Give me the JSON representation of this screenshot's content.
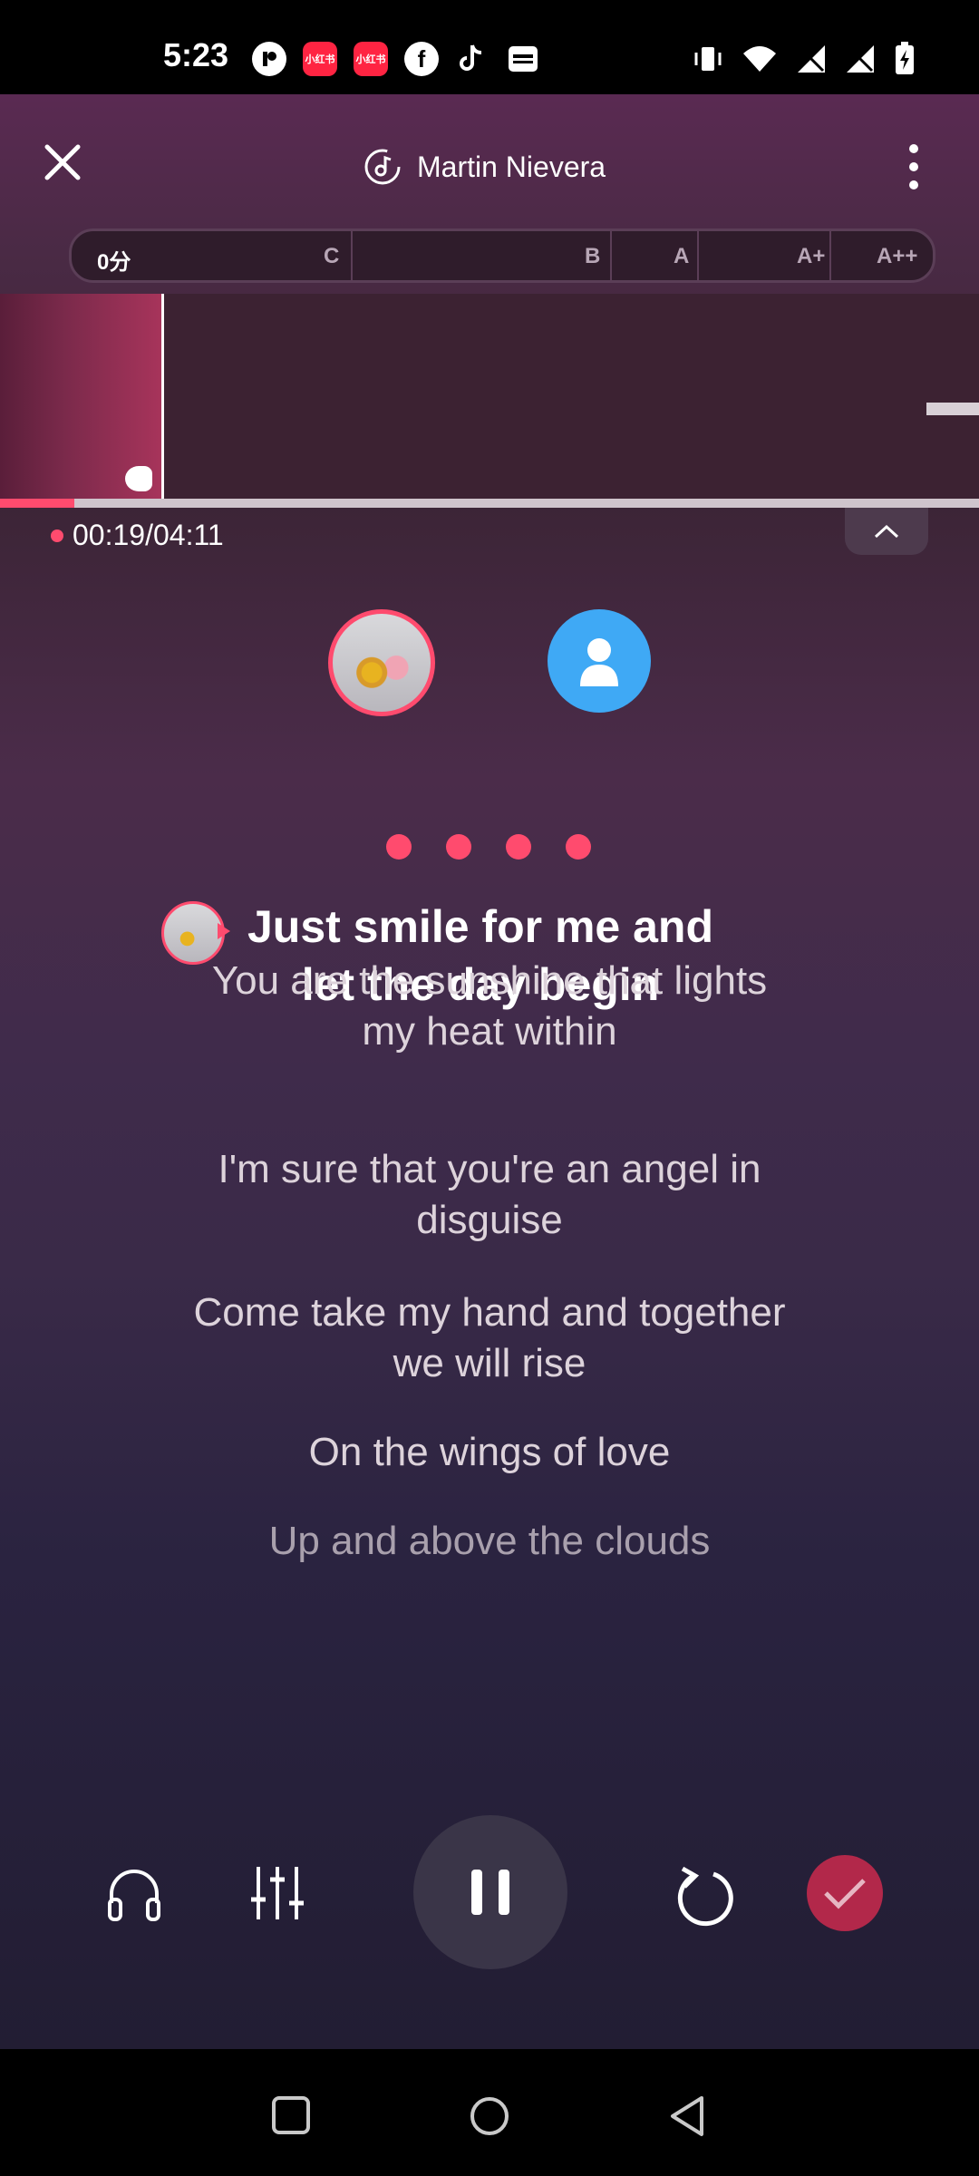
{
  "status_bar": {
    "time": "5:23",
    "left_icons": [
      "app-badge-icon",
      "xiaohongshu-icon",
      "xiaohongshu-icon",
      "facebook-icon",
      "tiktok-icon",
      "wallet-icon"
    ],
    "xhs_label": "小红书",
    "right_icons": [
      "vibrate-icon",
      "wifi-icon",
      "no-signal-icon",
      "no-signal-icon",
      "battery-charging-icon"
    ]
  },
  "header": {
    "song_artist": "Martin Nievera",
    "close_icon": "close-icon",
    "menu_icon": "more-vertical-icon"
  },
  "score": {
    "current": "0分",
    "grades": [
      "C",
      "B",
      "A",
      "A+",
      "A++"
    ]
  },
  "playback": {
    "elapsed": "00:19",
    "total": "04:11",
    "time_display": "00:19/04:11",
    "progress_fraction": 0.076
  },
  "lyrics": {
    "current": "Just smile for me and let the day begin",
    "upcoming": [
      "You are the sunshine that lights my heat within",
      "I'm sure that you're an angel in disguise",
      "Come take my hand and together we will rise",
      "On the wings of love",
      "Up and above the clouds"
    ]
  },
  "countdown_dots": 4,
  "colors": {
    "accent": "#ff4b6e",
    "accent_dark": "#b2284a",
    "avatar_blue": "#3fa9f5"
  },
  "controls": [
    "headphones-icon",
    "equalizer-icon",
    "pause-icon",
    "restart-icon",
    "check-icon"
  ]
}
